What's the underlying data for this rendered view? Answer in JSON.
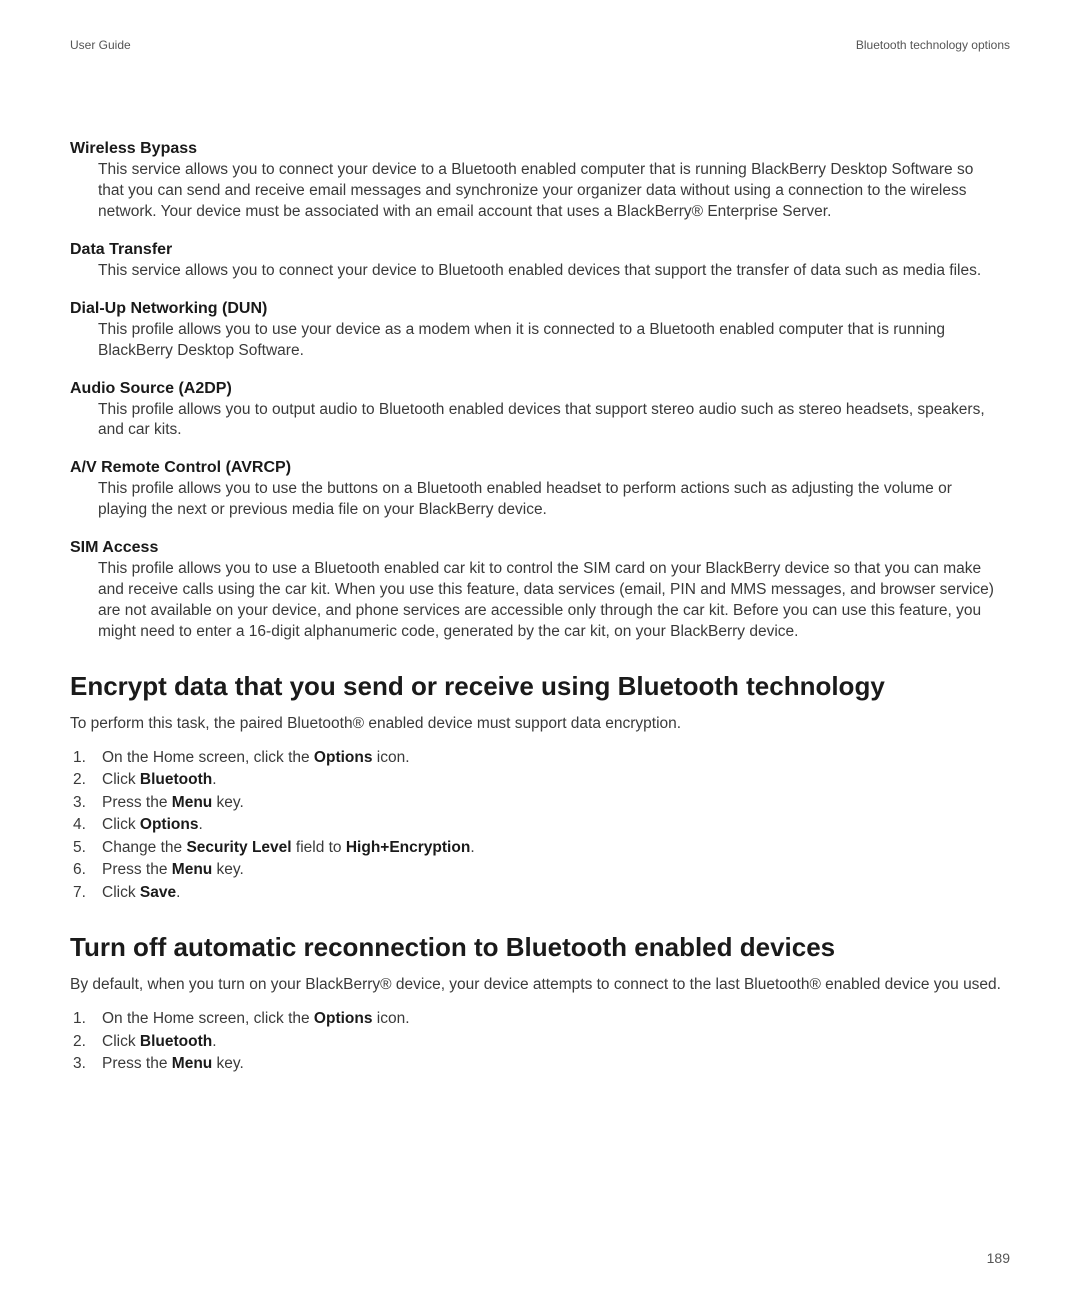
{
  "header": {
    "left": "User Guide",
    "right": "Bluetooth technology options"
  },
  "profiles": [
    {
      "title": "Wireless Bypass",
      "body": "This service allows you to connect your device to a Bluetooth enabled computer that is running BlackBerry Desktop Software so that you can send and receive email messages and synchronize your organizer data without using a connection to the wireless network. Your device must be associated with an email account that uses a BlackBerry® Enterprise Server."
    },
    {
      "title": "Data Transfer",
      "body": "This service allows you to connect your device to Bluetooth enabled devices that support the transfer of data such as media files."
    },
    {
      "title": "Dial-Up Networking (DUN)",
      "body": "This profile allows you to use your device as a modem when it is connected to a Bluetooth enabled computer that is running BlackBerry Desktop Software."
    },
    {
      "title": "Audio Source (A2DP)",
      "body": "This profile allows you to output audio to Bluetooth enabled devices that support stereo audio such as stereo headsets, speakers, and car kits."
    },
    {
      "title": "A/V Remote Control (AVRCP)",
      "body": "This profile allows you to use the buttons on a Bluetooth enabled headset to perform actions such as adjusting the volume or playing the next or previous media file on your BlackBerry device."
    },
    {
      "title": "SIM Access",
      "body": "This profile allows you to use a Bluetooth enabled car kit to control the SIM card on your BlackBerry device so that you can make and receive calls using the car kit. When you use this feature, data services (email, PIN and MMS messages, and browser service) are not available on your device, and phone services are accessible only through the car kit. Before you can use this feature, you might need to enter a 16-digit alphanumeric code, generated by the car kit, on your BlackBerry device."
    }
  ],
  "section1": {
    "heading": "Encrypt data that you send or receive using Bluetooth technology",
    "intro": "To perform this task, the paired Bluetooth® enabled device must support data encryption.",
    "steps": [
      {
        "pre": "On the Home screen, click the ",
        "bold": "Options",
        "post": " icon."
      },
      {
        "pre": "Click ",
        "bold": "Bluetooth",
        "post": "."
      },
      {
        "pre": "Press the ",
        "bold": "Menu",
        "post": " key."
      },
      {
        "pre": "Click ",
        "bold": "Options",
        "post": "."
      },
      {
        "pre": "Change the ",
        "bold": "Security Level",
        "mid": " field to ",
        "bold2": "High+Encryption",
        "post": "."
      },
      {
        "pre": "Press the ",
        "bold": "Menu",
        "post": " key."
      },
      {
        "pre": "Click ",
        "bold": "Save",
        "post": "."
      }
    ]
  },
  "section2": {
    "heading": "Turn off automatic reconnection to Bluetooth enabled devices",
    "intro": "By default, when you turn on your BlackBerry® device, your device attempts to connect to the last Bluetooth® enabled device you used.",
    "steps": [
      {
        "pre": "On the Home screen, click the ",
        "bold": "Options",
        "post": " icon."
      },
      {
        "pre": "Click ",
        "bold": "Bluetooth",
        "post": "."
      },
      {
        "pre": "Press the ",
        "bold": "Menu",
        "post": " key."
      }
    ]
  },
  "pageNumber": "189"
}
